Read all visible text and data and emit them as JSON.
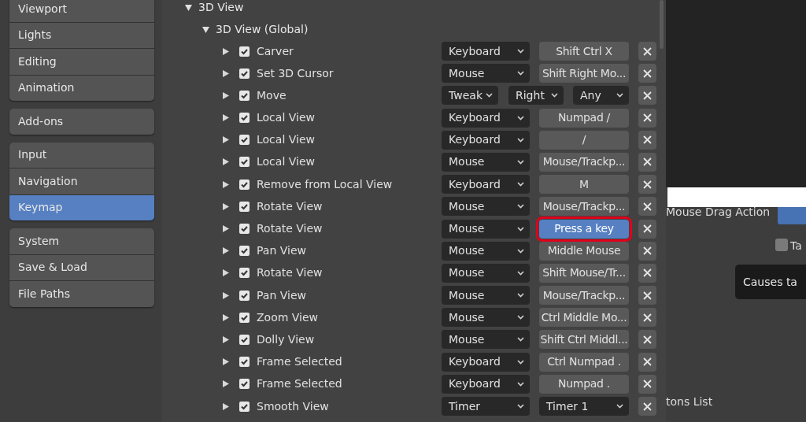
{
  "sidebar": {
    "groups": [
      {
        "items": [
          {
            "label": "Viewport",
            "selected": false
          },
          {
            "label": "Lights",
            "selected": false
          },
          {
            "label": "Editing",
            "selected": false
          },
          {
            "label": "Animation",
            "selected": false
          }
        ]
      },
      {
        "items": [
          {
            "label": "Add-ons",
            "selected": false
          }
        ]
      },
      {
        "items": [
          {
            "label": "Input",
            "selected": false
          },
          {
            "label": "Navigation",
            "selected": false
          },
          {
            "label": "Keymap",
            "selected": true
          }
        ]
      },
      {
        "items": [
          {
            "label": "System",
            "selected": false
          },
          {
            "label": "Save & Load",
            "selected": false
          },
          {
            "label": "File Paths",
            "selected": false
          }
        ]
      }
    ]
  },
  "keymap": {
    "title": "3D View",
    "expanded": true,
    "children": [
      {
        "title": "3D View (Global)",
        "expanded": true,
        "items": [
          {
            "kind": "key",
            "label": "Carver",
            "expanded": false,
            "checked": true,
            "type": "Keyboard",
            "key": "Shift Ctrl X",
            "selected": false
          },
          {
            "kind": "key",
            "label": "Set 3D Cursor",
            "expanded": false,
            "checked": true,
            "type": "Mouse",
            "key": "Shift Right Mo...",
            "selected": false
          },
          {
            "kind": "tweak",
            "label": "Move",
            "expanded": false,
            "checked": true,
            "type": "Tweak",
            "button": "Right",
            "direction": "Any"
          },
          {
            "kind": "key",
            "label": "Local View",
            "expanded": false,
            "checked": true,
            "type": "Keyboard",
            "key": "Numpad /",
            "selected": false
          },
          {
            "kind": "key",
            "label": "Local View",
            "expanded": false,
            "checked": true,
            "type": "Keyboard",
            "key": "/",
            "selected": false
          },
          {
            "kind": "key",
            "label": "Local View",
            "expanded": false,
            "checked": true,
            "type": "Mouse",
            "key": "Mouse/Trackp...",
            "selected": false
          },
          {
            "kind": "key",
            "label": "Remove from Local View",
            "expanded": false,
            "checked": true,
            "type": "Keyboard",
            "key": "M",
            "selected": false
          },
          {
            "kind": "key",
            "label": "Rotate View",
            "expanded": false,
            "checked": true,
            "type": "Mouse",
            "key": "Mouse/Trackp...",
            "selected": false
          },
          {
            "kind": "key",
            "label": "Rotate View",
            "expanded": false,
            "checked": true,
            "type": "Mouse",
            "key": "Press a key",
            "selected": true
          },
          {
            "kind": "key",
            "label": "Pan View",
            "expanded": false,
            "checked": true,
            "type": "Mouse",
            "key": "Middle Mouse",
            "selected": false
          },
          {
            "kind": "key",
            "label": "Rotate View",
            "expanded": false,
            "checked": true,
            "type": "Mouse",
            "key": "Shift Mouse/Tr...",
            "selected": false
          },
          {
            "kind": "key",
            "label": "Pan View",
            "expanded": false,
            "checked": true,
            "type": "Mouse",
            "key": "Mouse/Trackp...",
            "selected": false
          },
          {
            "kind": "key",
            "label": "Zoom View",
            "expanded": false,
            "checked": true,
            "type": "Mouse",
            "key": "Ctrl Middle Mo...",
            "selected": false
          },
          {
            "kind": "key",
            "label": "Dolly View",
            "expanded": false,
            "checked": true,
            "type": "Mouse",
            "key": "Shift Ctrl Middl...",
            "selected": false
          },
          {
            "kind": "key",
            "label": "Frame Selected",
            "expanded": false,
            "checked": true,
            "type": "Keyboard",
            "key": "Ctrl Numpad .",
            "selected": false
          },
          {
            "kind": "key",
            "label": "Frame Selected",
            "expanded": false,
            "checked": true,
            "type": "Keyboard",
            "key": "Numpad .",
            "selected": false
          },
          {
            "kind": "timer",
            "label": "Smooth View",
            "expanded": false,
            "checked": true,
            "type": "Timer",
            "timer": "Timer 1"
          }
        ]
      }
    ]
  },
  "background_window": {
    "drag_label": "Mouse Drag Action",
    "checkbox": {
      "label": "Ta",
      "checked": false
    },
    "tooltip": "Causes ta",
    "list_label": "tons List"
  }
}
